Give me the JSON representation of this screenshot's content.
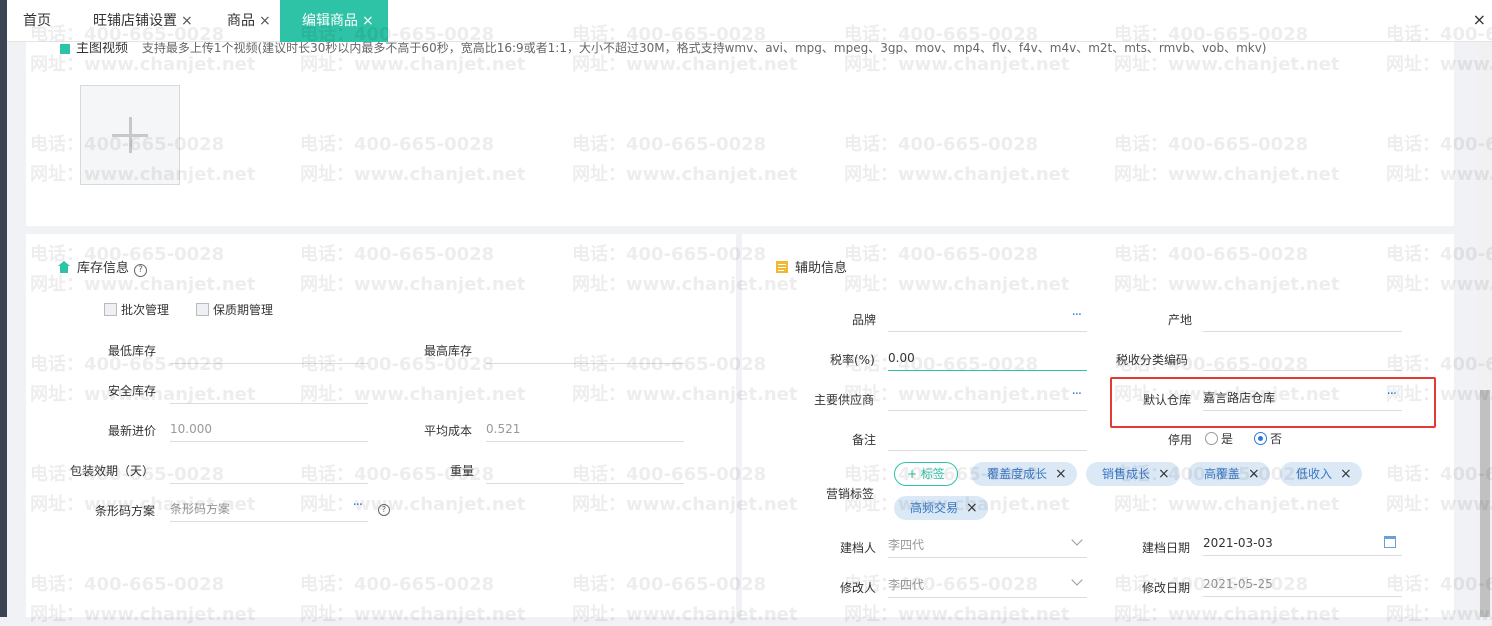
{
  "tabs": [
    {
      "label": "首页",
      "closable": false,
      "active": false
    },
    {
      "label": "旺铺店铺设置",
      "closable": true,
      "active": false
    },
    {
      "label": "商品",
      "closable": true,
      "active": false
    },
    {
      "label": "编辑商品",
      "closable": true,
      "active": true
    }
  ],
  "close_glyph": "×",
  "video": {
    "title": "主图视频",
    "hint": "支持最多上传1个视频(建议时长30秒以内最多不高于60秒，宽高比16:9或者1:1，大小不超过30M，格式支持wmv、avi、mpg、mpeg、3gp、mov、mp4、flv、f4v、m4v、m2t、mts、rmvb、vob、mkv)"
  },
  "inventory": {
    "title": "库存信息",
    "batch_label": "批次管理",
    "shelf_label": "保质期管理",
    "min_stock_label": "最低库存",
    "max_stock_label": "最高库存",
    "safe_stock_label": "安全库存",
    "latest_price_label": "最新进价",
    "latest_price_value": "10.000",
    "avg_cost_label": "平均成本",
    "avg_cost_value": "0.521",
    "pack_life_label": "包装效期（天）",
    "weight_label": "重量",
    "barcode_label": "条形码方案",
    "barcode_placeholder": "条形码方案"
  },
  "aux": {
    "title": "辅助信息",
    "brand_label": "品牌",
    "origin_label": "产地",
    "tax_label": "税率(%)",
    "tax_value": "0.00",
    "tax_code_label": "税收分类编码",
    "supplier_label": "主要供应商",
    "warehouse_label": "默认仓库",
    "warehouse_value": "嘉言路店仓库",
    "remark_label": "备注",
    "disable_label": "停用",
    "disable_yes": "是",
    "disable_no": "否",
    "marketing_label": "营销标签",
    "add_tag_label": "+ 标签",
    "tags": [
      "覆盖度成长",
      "销售成长",
      "高覆盖",
      "低收入",
      "高频交易"
    ],
    "creator_label": "建档人",
    "creator_value": "李四代",
    "create_date_label": "建档日期",
    "create_date_value": "2021-03-03",
    "modifier_label": "修改人",
    "modifier_value": "李四代",
    "modify_date_label": "修改日期",
    "modify_date_value": "2021-05-25"
  },
  "watermark": {
    "phone": "电话：400-665-0028",
    "site": "网址：www.chanjet.net"
  },
  "colors": {
    "accent": "#2ec3a6",
    "link": "#2b7bd8",
    "highlight": "#e53935"
  }
}
